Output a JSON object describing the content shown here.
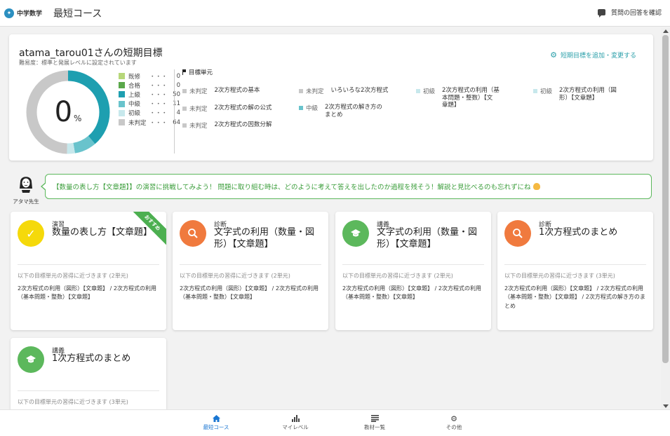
{
  "header": {
    "logo_text": "中学数学",
    "title": "最短コース",
    "help_link": "質問の回答を確認"
  },
  "goal": {
    "title": "atama_tarou01さんの短期目標",
    "subtitle": "難易度：標準と発展レベルに設定されています",
    "edit_label": "短期目標を追加・変更する",
    "progress_value": "0",
    "progress_unit": "%",
    "legend": [
      {
        "label": "既修",
        "dots": "・・・",
        "count": "0",
        "color": "#b7d77a"
      },
      {
        "label": "合格",
        "dots": "・・・",
        "count": "0",
        "color": "#5aa84a"
      },
      {
        "label": "上級",
        "dots": "・・・",
        "count": "50",
        "color": "#1e9fb0"
      },
      {
        "label": "中級",
        "dots": "・・・",
        "count": "11",
        "color": "#69c3cc"
      },
      {
        "label": "初級",
        "dots": "・・・",
        "count": "4",
        "color": "#c7e8ec"
      },
      {
        "label": "未判定",
        "dots": "・・・",
        "count": "64",
        "color": "#c8c8c8"
      }
    ],
    "donut_segments": [
      {
        "value": 50,
        "color": "#1e9fb0"
      },
      {
        "value": 11,
        "color": "#69c3cc"
      },
      {
        "value": 4,
        "color": "#c7e8ec"
      },
      {
        "value": 64,
        "color": "#c8c8c8"
      }
    ],
    "units_heading": "目標単元",
    "units": [
      {
        "level": "未判定",
        "name": "2次方程式の基本",
        "color": "#c8c8c8"
      },
      {
        "level": "未判定",
        "name": "2次方程式の解の公式",
        "color": "#c8c8c8"
      },
      {
        "level": "未判定",
        "name": "2次方程式の因数分解",
        "color": "#c8c8c8"
      },
      {
        "level": "未判定",
        "name": "いろいろな2次方程式",
        "color": "#c8c8c8"
      },
      {
        "level": "中級",
        "name": "2次方程式の解き方の\nまとめ",
        "color": "#69c3cc"
      },
      {
        "level": "初級",
        "name": "2次方程式の利用（基\n本問題・整数）【文\n章題】",
        "color": "#c7e8ec"
      },
      {
        "level": "初級",
        "name": "2次方程式の利用（図\n形）【文章題】",
        "color": "#c7e8ec"
      }
    ]
  },
  "teacher": {
    "name": "アタマ先生",
    "message": "【数量の表し方【文章題】】の演習に挑戦してみよう！ 問題に取り組む時は、どのように考えて答えを出したのか過程を残そう！解説と見比べるのも忘れずにね"
  },
  "cards": [
    {
      "type": "演習",
      "title": "数量の表し方【文章題】",
      "badge": "おすすめ",
      "icon": "check-icon",
      "color": "#f5d90a",
      "note": "以下の目標単元の習得に近づきます (2単元)",
      "units": "2次方程式の利用（図形）【文章題】 / 2次方程式の利用（基本問題・整数）【文章題】"
    },
    {
      "type": "診断",
      "title": "文字式の利用（数量・図形）【文章題】",
      "icon": "search-icon",
      "color": "#f07a3e",
      "note": "以下の目標単元の習得に近づきます (2単元)",
      "units": "2次方程式の利用（図形）【文章題】 / 2次方程式の利用（基本問題・整数）【文章題】"
    },
    {
      "type": "講義",
      "title": "文字式の利用（数量・図形）【文章題】",
      "icon": "graduation-cap-icon",
      "color": "#5cb85c",
      "note": "以下の目標単元の習得に近づきます (2単元)",
      "units": "2次方程式の利用（図形）【文章題】 / 2次方程式の利用（基本問題・整数）【文章題】"
    },
    {
      "type": "診断",
      "title": "1次方程式のまとめ",
      "icon": "search-icon",
      "color": "#f07a3e",
      "note": "以下の目標単元の習得に近づきます (3単元)",
      "units": "2次方程式の利用（図形）【文章題】 / 2次方程式の利用（基本問題・整数）【文章題】 / 2次方程式の解き方のまとめ"
    },
    {
      "type": "講義",
      "title": "1次方程式のまとめ",
      "icon": "graduation-cap-icon",
      "color": "#5cb85c",
      "note": "以下の目標単元の習得に近づきます (3単元)",
      "units": ""
    }
  ],
  "nav": [
    {
      "label": "最短コース",
      "icon": "home-icon",
      "active": true
    },
    {
      "label": "マイレベル",
      "icon": "bar-chart-icon",
      "active": false
    },
    {
      "label": "教材一覧",
      "icon": "list-icon",
      "active": false
    },
    {
      "label": "その他",
      "icon": "gear-icon",
      "active": false
    }
  ]
}
